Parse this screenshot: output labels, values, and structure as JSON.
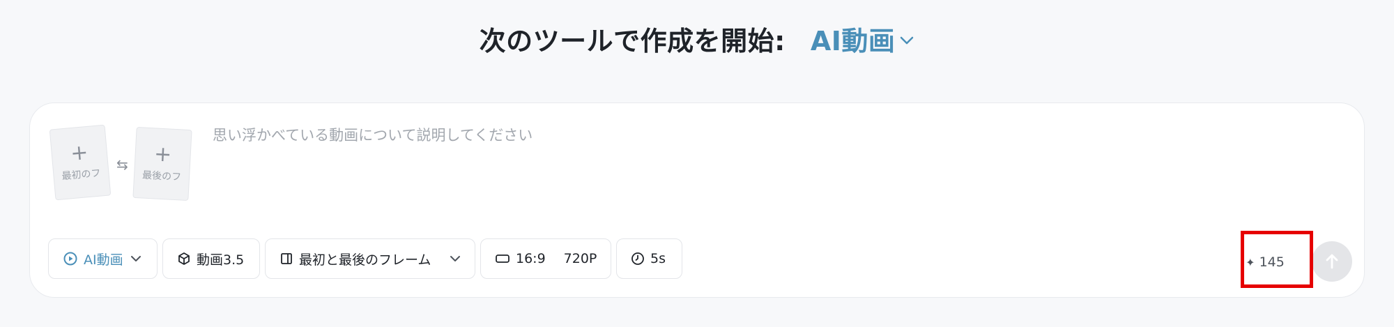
{
  "heading": {
    "prefix": "次のツールで作成を開始:",
    "tool": "AI動画",
    "chevron_icon": "chevron-down-icon"
  },
  "frames": {
    "first_label": "最初のフ",
    "last_label": "最後のフ",
    "plus_symbol": "+",
    "swap_symbol": "⇆"
  },
  "prompt": {
    "placeholder": "思い浮かべている動画について説明してください",
    "value": ""
  },
  "toolbar": {
    "mode_label": "AI動画",
    "model_label": "動画3.5",
    "frames_label": "最初と最後のフレーム",
    "ratio_label": "16:9",
    "resolution_label": "720P",
    "duration_label": "5s"
  },
  "credits": {
    "spark_symbol": "✦",
    "value": "145"
  },
  "colors": {
    "accent": "#4a8fb8",
    "highlight": "#e60000",
    "background": "#f7f8fa"
  }
}
